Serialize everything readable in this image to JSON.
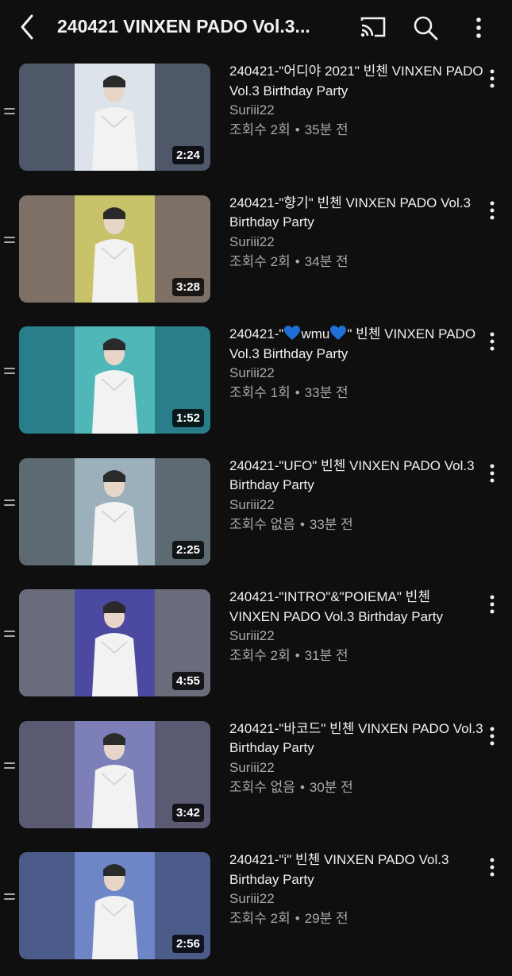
{
  "header": {
    "title": "240421 VINXEN PADO Vol.3...",
    "icons": [
      "back-arrow-icon",
      "cast-icon",
      "search-icon",
      "more-vert-icon"
    ]
  },
  "videos": [
    {
      "title": "240421-\"어디야 2021\" 빈첸 VINXEN PADO Vol.3 Birthday Party",
      "channel": "Suriii22",
      "views": "조회수 2회",
      "age": "35분 전",
      "duration": "2:24",
      "bg": "#4e5868",
      "center": "#dde3ea"
    },
    {
      "title": "240421-\"향기\" 빈첸 VINXEN PADO Vol.3 Birthday Party",
      "channel": "Suriii22",
      "views": "조회수 2회",
      "age": "34분 전",
      "duration": "3:28",
      "bg": "#7d7066",
      "center": "#c8c26a"
    },
    {
      "title_prefix": "240421-\"",
      "title_mid": "wmu",
      "title_suffix": "\" 빈첸 VINXEN PADO Vol.3 Birthday Party",
      "channel": "Suriii22",
      "views": "조회수 1회",
      "age": "33분 전",
      "duration": "1:52",
      "bg": "#2a7e8c",
      "center": "#4fb7b8",
      "heart_color": "#1f6fd6"
    },
    {
      "title": "240421-\"UFO\" 빈첸 VINXEN PADO Vol.3 Birthday Party",
      "channel": "Suriii22",
      "views": "조회수 없음",
      "age": "33분 전",
      "duration": "2:25",
      "bg": "#5d6a72",
      "center": "#9bb0bb"
    },
    {
      "title": "240421-\"INTRO\"&\"POIEMA\" 빈첸 VINXEN PADO Vol.3 Birthday Party",
      "channel": "Suriii22",
      "views": "조회수 2회",
      "age": "31분 전",
      "duration": "4:55",
      "bg": "#6a6c7c",
      "center": "#4c4aa0"
    },
    {
      "title": "240421-\"바코드\" 빈첸 VINXEN PADO Vol.3 Birthday Party",
      "channel": "Suriii22",
      "views": "조회수 없음",
      "age": "30분 전",
      "duration": "3:42",
      "bg": "#5a5a72",
      "center": "#7d80b8"
    },
    {
      "title": "240421-\"i\" 빈첸 VINXEN PADO Vol.3 Birthday Party",
      "channel": "Suriii22",
      "views": "조회수 2회",
      "age": "29분 전",
      "duration": "2:56",
      "bg": "#4c5c8a",
      "center": "#6f86c6"
    }
  ]
}
